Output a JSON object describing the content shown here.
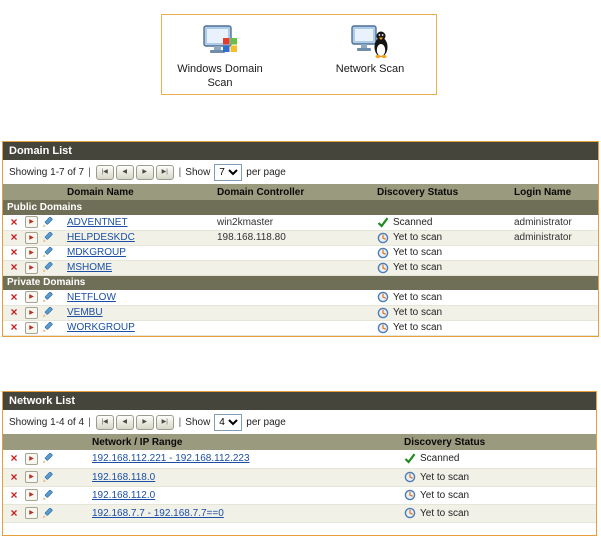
{
  "colors": {
    "panel_border": "#E5A03C",
    "panel_header_bg": "#45453C",
    "column_header_bg": "#9A9A7F",
    "group_row_bg": "#6F6F57",
    "link": "#1B4FA5",
    "scanned_green": "#1F8A1F",
    "pending_blue": "#4E7DB5",
    "pending_orange": "#E07A1F"
  },
  "scan_options": {
    "items": [
      {
        "id": "windows-domain-scan",
        "label": "Windows Domain Scan",
        "icon": "windows-domain-scan-icon"
      },
      {
        "id": "network-scan",
        "label": "Network Scan",
        "icon": "network-scan-icon"
      }
    ]
  },
  "pager_icons": {
    "first": "|◀",
    "prev": "◀",
    "next": "▶",
    "last": "▶|",
    "separator": "|"
  },
  "domain_list": {
    "title": "Domain List",
    "paging": {
      "showing": "Showing 1-7 of 7",
      "show_label": "Show",
      "per_page": "7",
      "suffix": "per page"
    },
    "columns": [
      "Domain Name",
      "Domain Controller",
      "Discovery Status",
      "Login Name"
    ],
    "groups": [
      {
        "label": "Public Domains",
        "rows": [
          {
            "name": "ADVENTNET",
            "controller": "win2kmaster",
            "status": "Scanned",
            "scanned": true,
            "login": "administrator"
          },
          {
            "name": "HELPDESKDC",
            "controller": "198.168.118.80",
            "status": "Yet to scan",
            "scanned": false,
            "login": "administrator"
          },
          {
            "name": "MDKGROUP",
            "controller": "",
            "status": "Yet to scan",
            "scanned": false,
            "login": ""
          },
          {
            "name": "MSHOME",
            "controller": "",
            "status": "Yet to scan",
            "scanned": false,
            "login": ""
          }
        ]
      },
      {
        "label": "Private Domains",
        "rows": [
          {
            "name": "NETFLOW",
            "controller": "",
            "status": "Yet to scan",
            "scanned": false,
            "login": ""
          },
          {
            "name": "VEMBU",
            "controller": "",
            "status": "Yet to scan",
            "scanned": false,
            "login": ""
          },
          {
            "name": "WORKGROUP",
            "controller": "",
            "status": "Yet to scan",
            "scanned": false,
            "login": ""
          }
        ]
      }
    ]
  },
  "network_list": {
    "title": "Network List",
    "paging": {
      "showing": "Showing 1-4 of 4",
      "show_label": "Show",
      "per_page": "4",
      "suffix": "per page"
    },
    "columns": [
      "Network / IP Range",
      "Discovery Status"
    ],
    "rows": [
      {
        "range": "192.168.112.221 - 192.168.112.223",
        "status": "Scanned",
        "scanned": true
      },
      {
        "range": "192.168.118.0",
        "status": "Yet to scan",
        "scanned": false
      },
      {
        "range": "192.168.112.0",
        "status": "Yet to scan",
        "scanned": false
      },
      {
        "range": "192.168.7.7 - 192.168.7.7==0",
        "status": "Yet to scan",
        "scanned": false
      }
    ]
  }
}
